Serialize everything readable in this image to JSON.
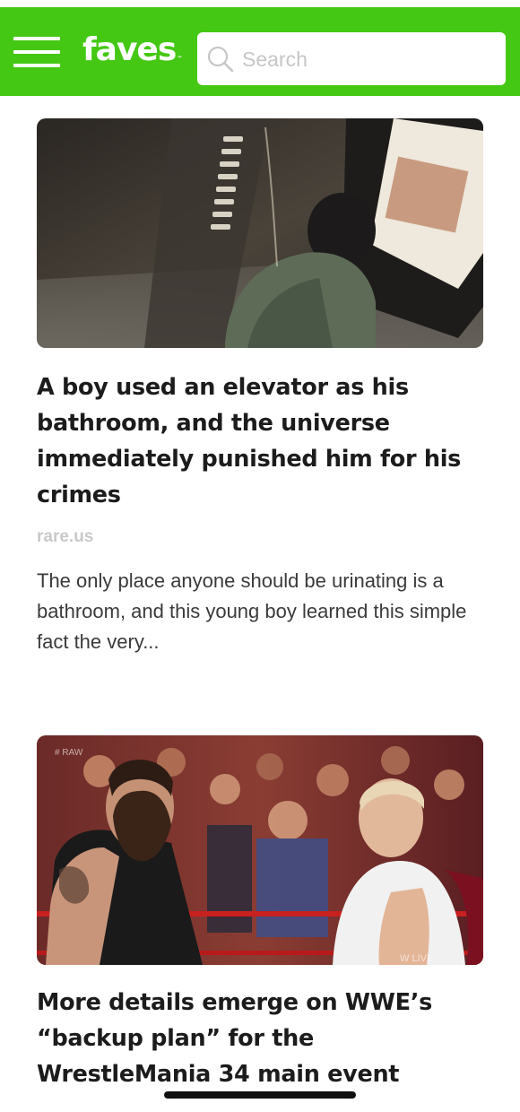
{
  "header": {
    "logo": "faves",
    "logo_tm": "™",
    "search_placeholder": "Search",
    "bg_color": "#44c814"
  },
  "icons": {
    "menu": "hamburger-menu-icon",
    "search": "magnifier-search-icon"
  },
  "articles": [
    {
      "headline": "A boy used an elevator as his bathroom, and the universe immediately punished him for his crimes",
      "source": "rare.us",
      "summary": "The only place anyone should be urinating is a bathroom, and this young boy learned this simple fact the very...",
      "image_alt": "Boy in green jacket urinating on elevator buttons"
    },
    {
      "headline": "More details emerge on WWE’s “backup plan” for the WrestleMania 34 main event",
      "image_alt": "Two wrestlers facing each other in front of a crowd",
      "image_watermark_left": "# RAW",
      "image_watermark_right": "W LIVE"
    }
  ]
}
